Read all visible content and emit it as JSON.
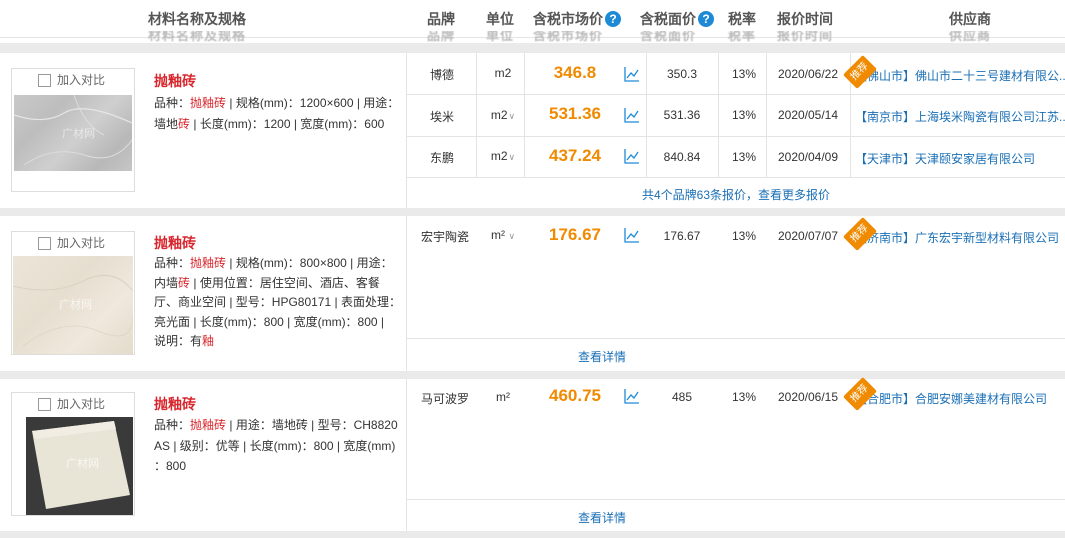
{
  "header": {
    "name_col": "材料名称及规格",
    "brand_col": "品牌",
    "unit_col": "单位",
    "market_price_col": "含税市场价",
    "face_price_col": "含税面价",
    "tax_col": "税率",
    "time_col": "报价时间",
    "supplier_col": "供应商",
    "help_mark": "?"
  },
  "compare_label": "加入对比",
  "watermark": "广材网",
  "recommend_tag": "推荐",
  "products": [
    {
      "title": "抛釉砖",
      "desc_line1_pre": "品种：",
      "desc_line1_hl": "抛釉砖",
      "desc_line1_post": " | 规格(mm)：1200×600 | 用途：",
      "desc_line2_pre": "墙地",
      "desc_line2_hl": "砖",
      "desc_line2_post": " | 长度(mm)：1200 | 宽度(mm)：600",
      "quotes": [
        {
          "brand": "博德",
          "unit": "m2",
          "price": "346.8",
          "face": "350.3",
          "tax": "13%",
          "date": "2020/06/22",
          "supplier": "【佛山市】佛山市二十三号建材有限公..."
        },
        {
          "brand": "埃米",
          "unit": "m2",
          "price": "531.36",
          "face": "531.36",
          "tax": "13%",
          "date": "2020/05/14",
          "supplier": "【南京市】上海埃米陶瓷有限公司江苏..."
        },
        {
          "brand": "东鹏",
          "unit": "m2",
          "price": "437.24",
          "face": "840.84",
          "tax": "13%",
          "date": "2020/04/09",
          "supplier": "【天津市】天津颐安家居有限公司"
        }
      ],
      "more": "共4个品牌63条报价，查看更多报价"
    },
    {
      "title": "抛釉砖",
      "desc_l1_pre": "品种：",
      "desc_l1_hl": "抛釉砖",
      "desc_l1_post": " | 规格(mm)：800×800 | 用途：",
      "desc_l2_pre": "内墙",
      "desc_l2_hl": "砖",
      "desc_l2_post": " | 使用位置：居住空间、酒店、客餐",
      "desc_l3": "厅、商业空间 | 型号：HPG80171 | 表面处理：",
      "desc_l4": "亮光面 | 长度(mm)：800 | 宽度(mm)：800 |",
      "desc_l5_pre": "说明：有",
      "desc_l5_hl": "釉",
      "quote": {
        "brand": "宏宇陶瓷",
        "unit": "m²",
        "price": "176.67",
        "face": "176.67",
        "tax": "13%",
        "date": "2020/07/07",
        "supplier": "【济南市】广东宏宇新型材料有限公司"
      },
      "more": "查看详情"
    },
    {
      "title": "抛釉砖",
      "desc_l1_pre": "品种：",
      "desc_l1_hl": "抛釉砖",
      "desc_l1_post": " | 用途：墙地砖 | 型号：CH8820",
      "desc_l2": "AS | 级别：优等 | 长度(mm)：800 | 宽度(mm)",
      "desc_l3": "：800",
      "quote": {
        "brand": "马可波罗",
        "unit": "m²",
        "price": "460.75",
        "face": "485",
        "tax": "13%",
        "date": "2020/06/15",
        "supplier": "【合肥市】合肥安娜美建材有限公司"
      },
      "more": "查看详情"
    }
  ],
  "colors": {
    "price": "#f08a00",
    "link": "#1a6fb5",
    "highlight": "#d9262c",
    "help": "#1e8ad6"
  }
}
